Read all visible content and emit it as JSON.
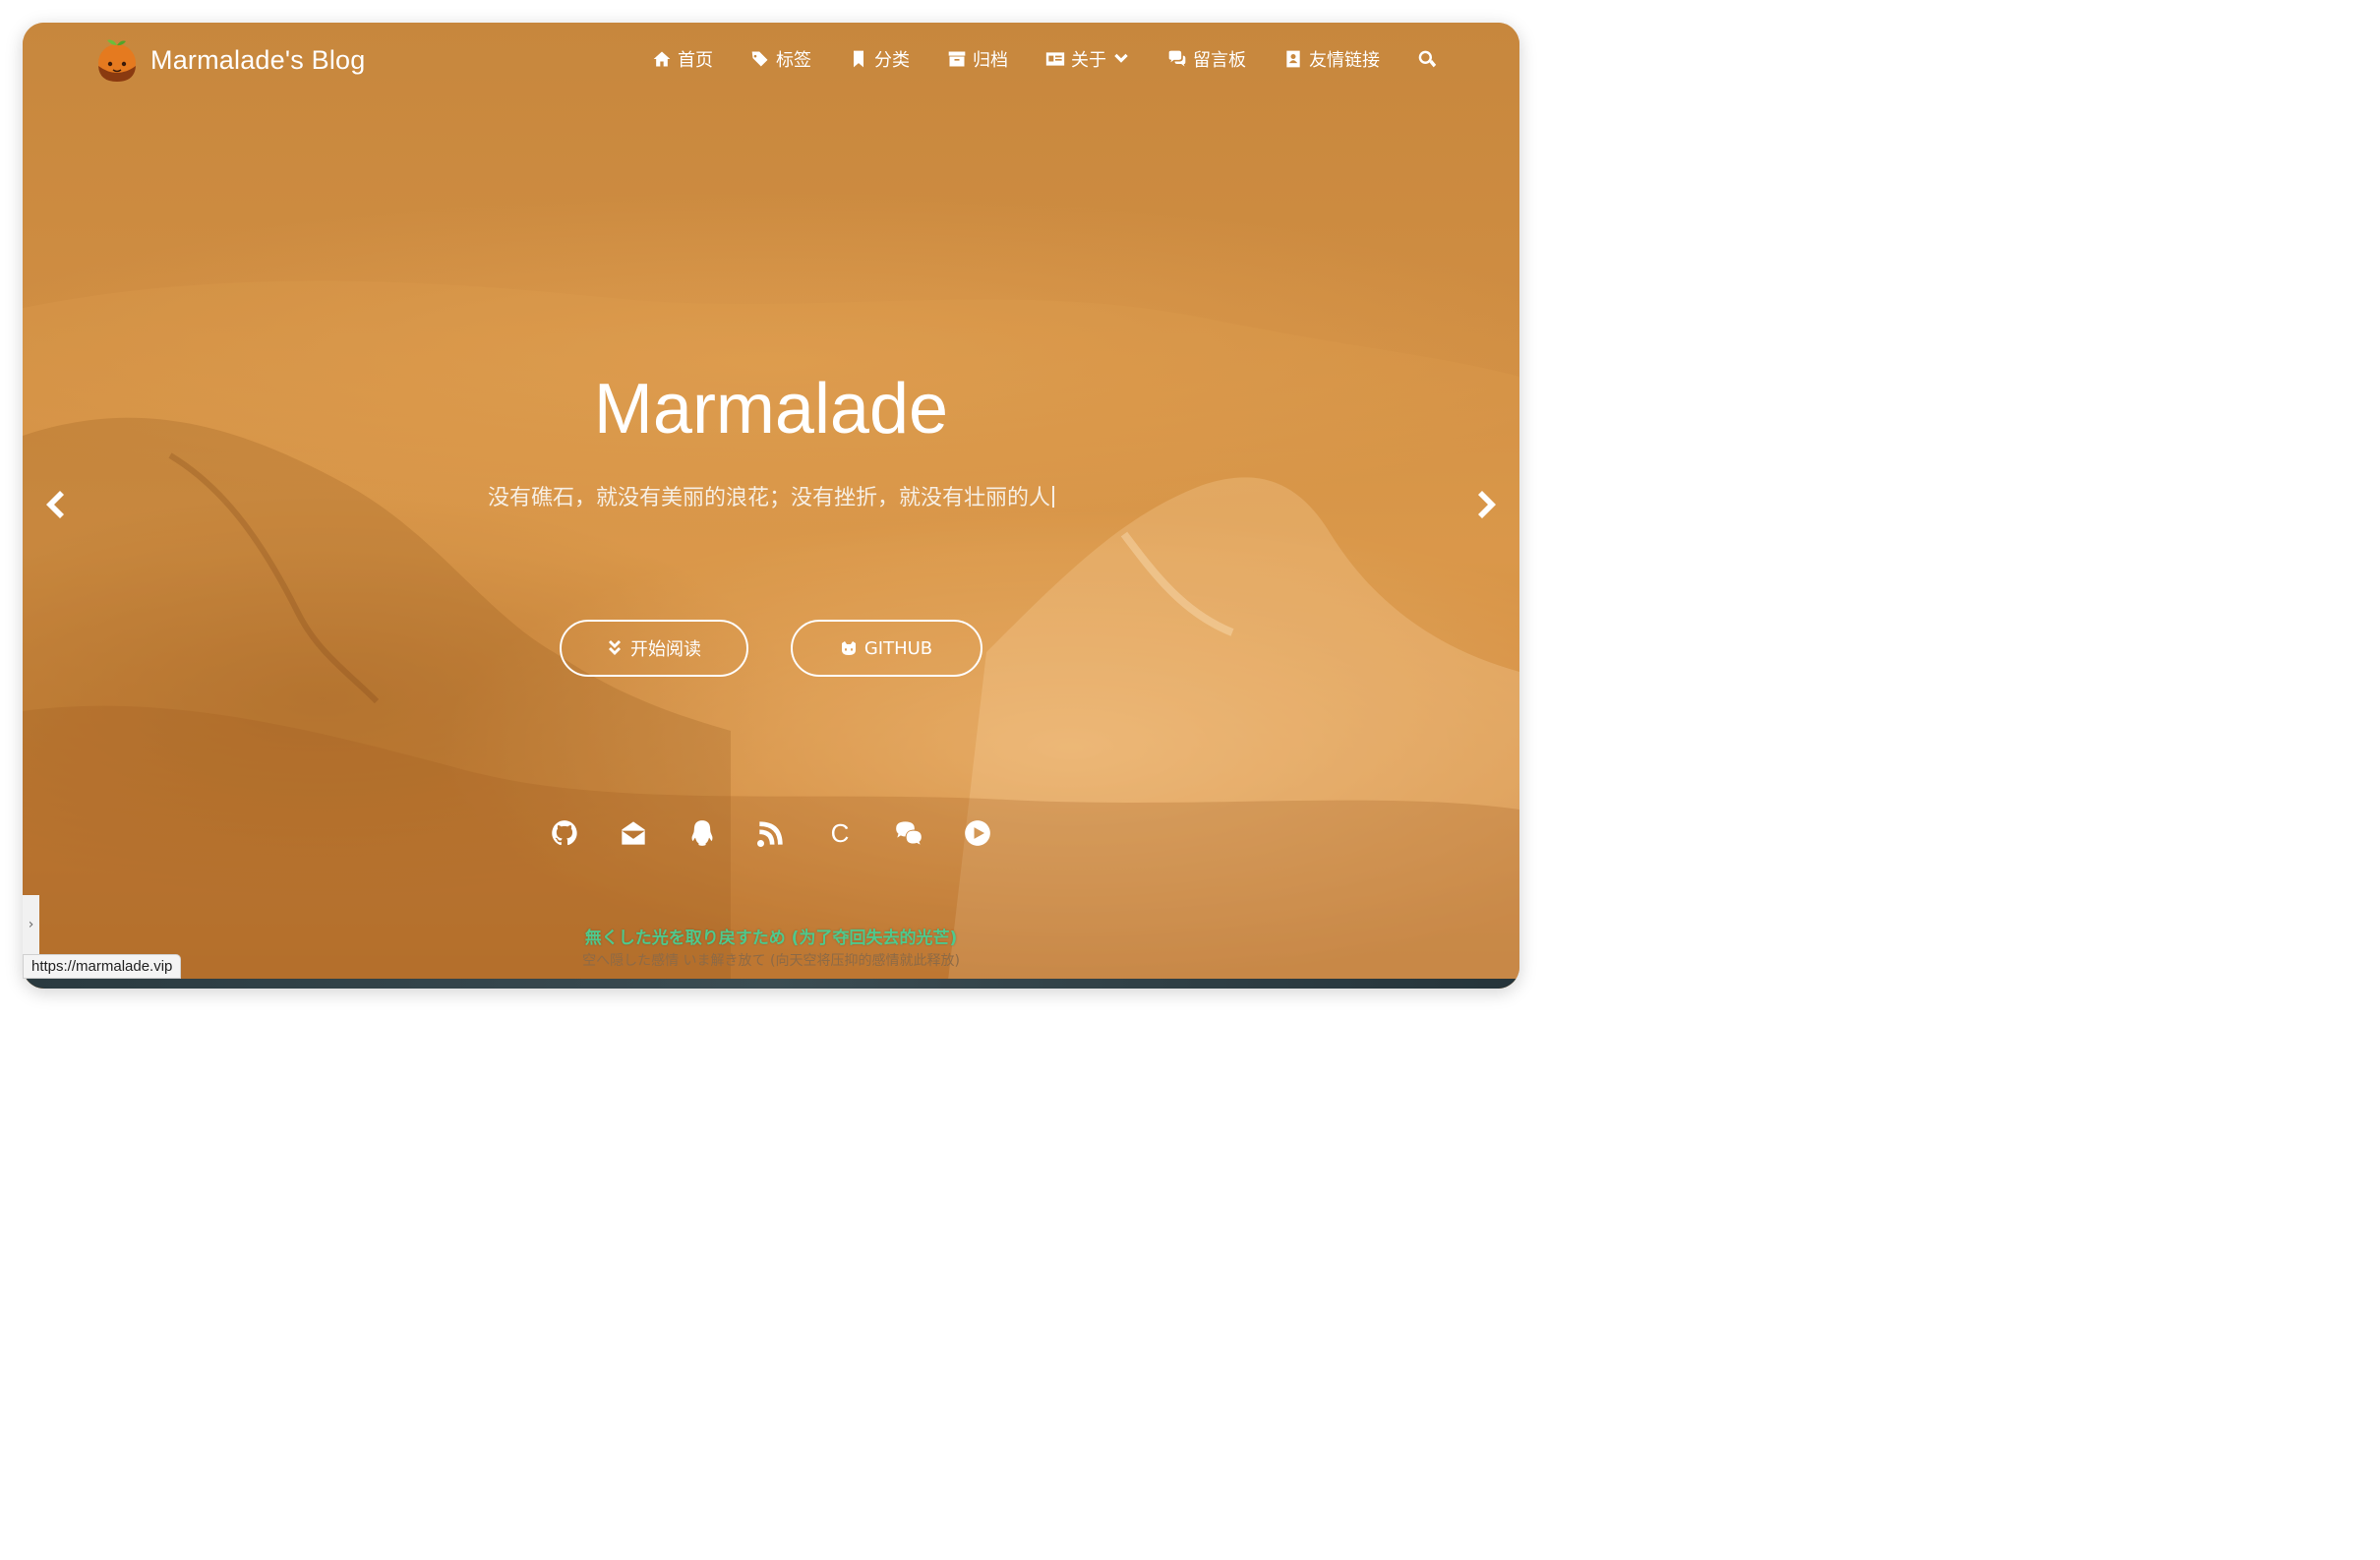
{
  "brand": {
    "title": "Marmalade's Blog",
    "logo_icon": "orange-logo-icon"
  },
  "nav": {
    "items": [
      {
        "label": "首页",
        "icon": "home-icon"
      },
      {
        "label": "标签",
        "icon": "tags-icon"
      },
      {
        "label": "分类",
        "icon": "bookmark-icon"
      },
      {
        "label": "归档",
        "icon": "archive-icon"
      },
      {
        "label": "关于",
        "icon": "id-card-icon"
      },
      {
        "label": "留言板",
        "icon": "comments-icon"
      },
      {
        "label": "友情链接",
        "icon": "contact-icon"
      }
    ],
    "search_icon": "search-icon"
  },
  "hero": {
    "title": "Marmalade",
    "subtitle": "没有礁石，就没有美丽的浪花；没有挫折，就没有壮丽的人",
    "read_button": "开始阅读",
    "github_button": "GITHUB"
  },
  "socials": [
    "github-icon",
    "email-icon",
    "qq-icon",
    "rss-icon",
    "csdn-icon",
    "wechat-icon",
    "bilibili-play-icon"
  ],
  "csdn_letter": "C",
  "lyrics": {
    "line1": "無くした光を取り戻すため (为了夺回失去的光芒)",
    "line2": "空へ隠した感情 いま解き放て (向天空将压抑的感情就此释放)"
  },
  "status_url": "https://marmalade.vip",
  "colors": {
    "hero_orange": "#cf8d42",
    "lyric_green": "#4ec98d"
  }
}
